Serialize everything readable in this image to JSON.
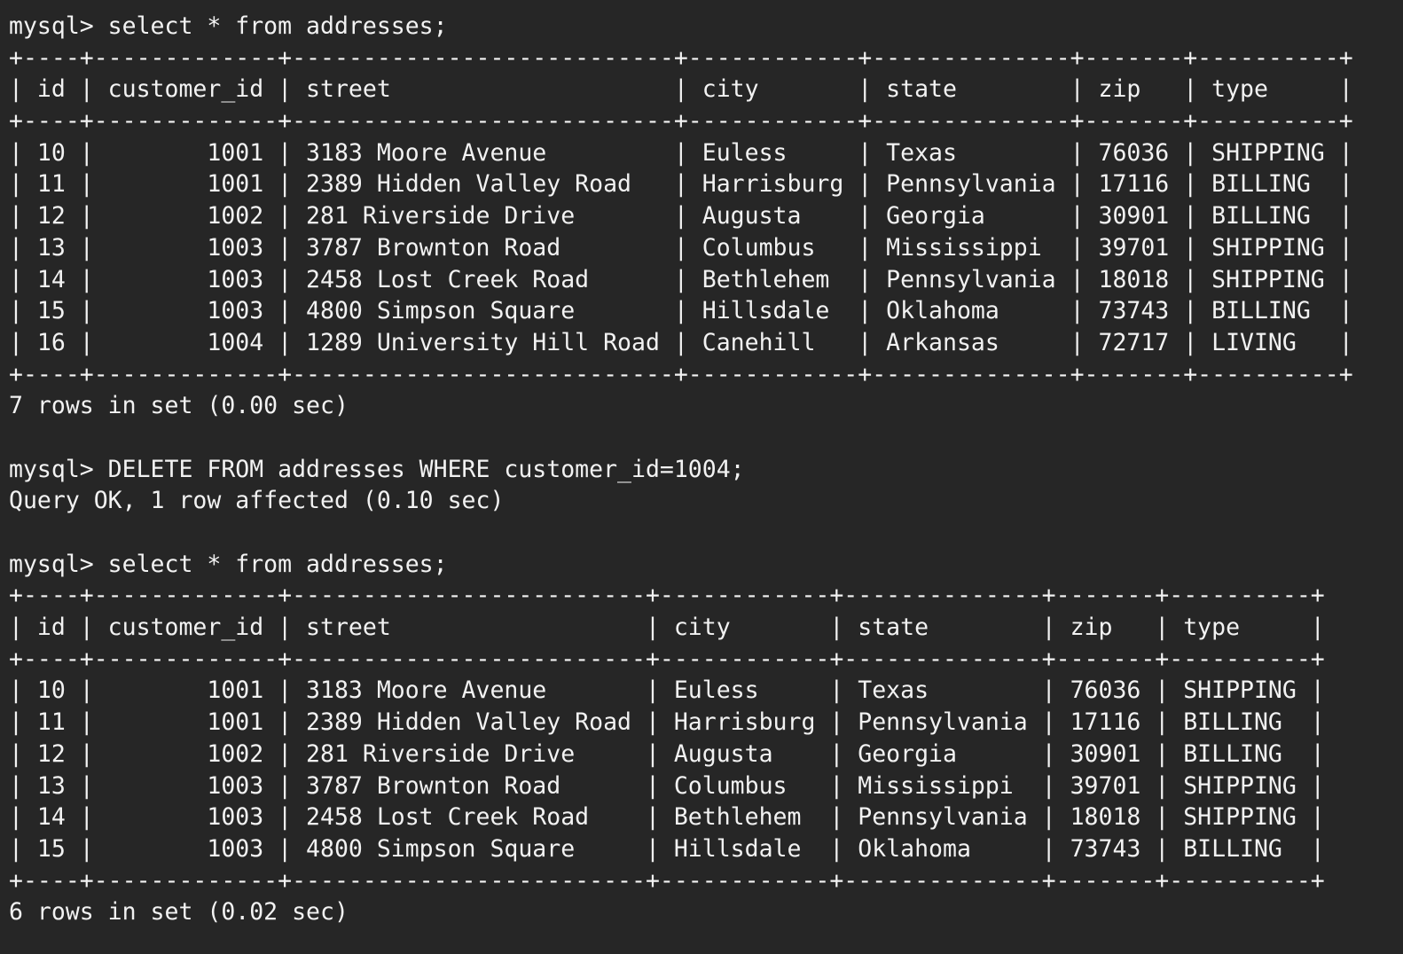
{
  "terminal": {
    "theme": {
      "background": "#262626",
      "foreground": "#f2f2f2"
    },
    "prompt": "mysql>",
    "blocks": [
      {
        "command": "select * from addresses;",
        "result": {
          "columns": [
            "id",
            "customer_id",
            "street",
            "city",
            "state",
            "zip",
            "type"
          ],
          "rows": [
            [
              "10",
              "1001",
              "3183 Moore Avenue",
              "Euless",
              "Texas",
              "76036",
              "SHIPPING"
            ],
            [
              "11",
              "1001",
              "2389 Hidden Valley Road",
              "Harrisburg",
              "Pennsylvania",
              "17116",
              "BILLING"
            ],
            [
              "12",
              "1002",
              "281 Riverside Drive",
              "Augusta",
              "Georgia",
              "30901",
              "BILLING"
            ],
            [
              "13",
              "1003",
              "3787 Brownton Road",
              "Columbus",
              "Mississippi",
              "39701",
              "SHIPPING"
            ],
            [
              "14",
              "1003",
              "2458 Lost Creek Road",
              "Bethlehem",
              "Pennsylvania",
              "18018",
              "SHIPPING"
            ],
            [
              "15",
              "1003",
              "4800 Simpson Square",
              "Hillsdale",
              "Oklahoma",
              "73743",
              "BILLING"
            ],
            [
              "16",
              "1004",
              "1289 University Hill Road",
              "Canehill",
              "Arkansas",
              "72717",
              "LIVING"
            ]
          ],
          "status": "7 rows in set (0.00 sec)"
        }
      },
      {
        "command": "DELETE FROM addresses WHERE customer_id=1004;",
        "message": "Query OK, 1 row affected (0.10 sec)"
      },
      {
        "command": "select * from addresses;",
        "result": {
          "columns": [
            "id",
            "customer_id",
            "street",
            "city",
            "state",
            "zip",
            "type"
          ],
          "rows": [
            [
              "10",
              "1001",
              "3183 Moore Avenue",
              "Euless",
              "Texas",
              "76036",
              "SHIPPING"
            ],
            [
              "11",
              "1001",
              "2389 Hidden Valley Road",
              "Harrisburg",
              "Pennsylvania",
              "17116",
              "BILLING"
            ],
            [
              "12",
              "1002",
              "281 Riverside Drive",
              "Augusta",
              "Georgia",
              "30901",
              "BILLING"
            ],
            [
              "13",
              "1003",
              "3787 Brownton Road",
              "Columbus",
              "Mississippi",
              "39701",
              "SHIPPING"
            ],
            [
              "14",
              "1003",
              "2458 Lost Creek Road",
              "Bethlehem",
              "Pennsylvania",
              "18018",
              "SHIPPING"
            ],
            [
              "15",
              "1003",
              "4800 Simpson Square",
              "Hillsdale",
              "Oklahoma",
              "73743",
              "BILLING"
            ]
          ],
          "status": "6 rows in set (0.02 sec)"
        }
      }
    ]
  }
}
